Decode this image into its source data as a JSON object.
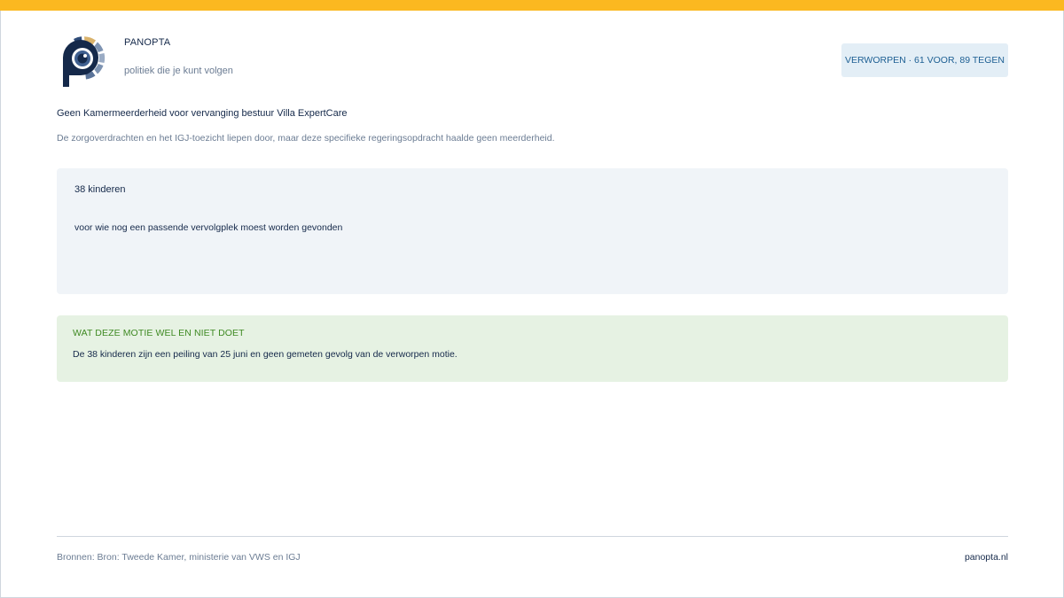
{
  "header": {
    "brand": "PANOPTA",
    "tagline": "politiek die je kunt volgen",
    "status_badge": "VERWORPEN · 61 VOOR, 89 TEGEN"
  },
  "summary": {
    "headline": "Geen Kamermeerderheid voor vervanging bestuur Villa ExpertCare",
    "subline": "De zorgoverdrachten en het IGJ-toezicht liepen door, maar deze specifieke regeringsopdracht haalde geen meerderheid."
  },
  "stat": {
    "number": "38 kinderen",
    "description": "voor wie nog een passende vervolgplek moest worden gevonden"
  },
  "note": {
    "title": "WAT DEZE MOTIE WEL EN NIET DOET",
    "text": "De 38 kinderen zijn een peiling van 25 juni en geen gemeten gevolg van de verworpen motie."
  },
  "footer": {
    "sources": "Bronnen: Bron: Tweede Kamer, ministerie van VWS en IGJ",
    "site": "panopta.nl"
  },
  "colors": {
    "accent_bar": "#fbb820",
    "navy": "#15294a",
    "badge_bg": "#e3eef6",
    "note_bg": "#e6f2e3",
    "note_title": "#3f8a23"
  }
}
